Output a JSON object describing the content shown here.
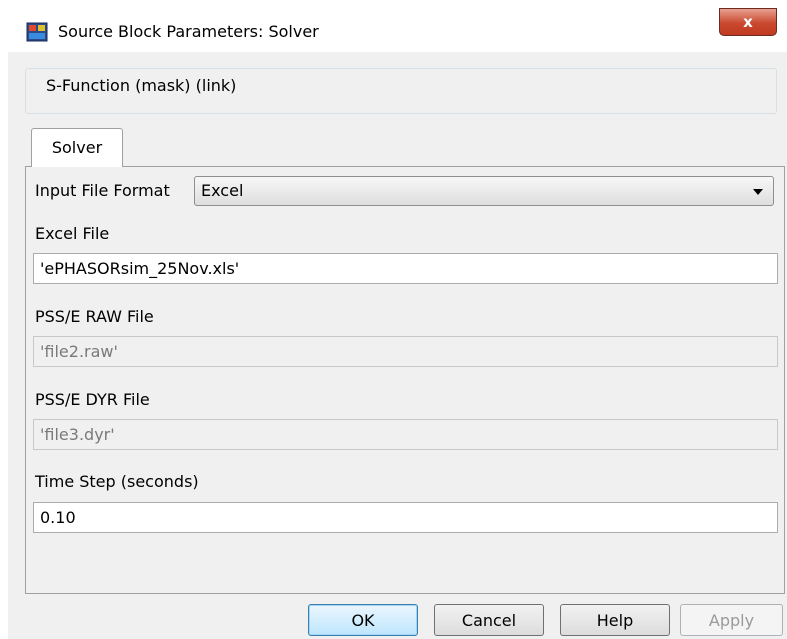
{
  "window": {
    "title": "Source Block Parameters: Solver",
    "close_label": "x",
    "icon": "simulink-block-icon"
  },
  "group": {
    "label": "S-Function (mask) (link)"
  },
  "tabs": [
    {
      "label": "Solver",
      "selected": true
    }
  ],
  "params": {
    "input_format": {
      "label": "Input File Format",
      "value": "Excel"
    },
    "excel_file": {
      "label": "Excel File",
      "value": "'ePHASORsim_25Nov.xls'",
      "enabled": true
    },
    "raw_file": {
      "label": "PSS/E RAW File",
      "value": "'file2.raw'",
      "enabled": false
    },
    "dyr_file": {
      "label": "PSS/E DYR File",
      "value": "'file3.dyr'",
      "enabled": false
    },
    "time_step": {
      "label": "Time Step (seconds)",
      "value": "0.10",
      "enabled": true
    }
  },
  "buttons": {
    "ok": "OK",
    "cancel": "Cancel",
    "help": "Help",
    "apply": "Apply"
  }
}
